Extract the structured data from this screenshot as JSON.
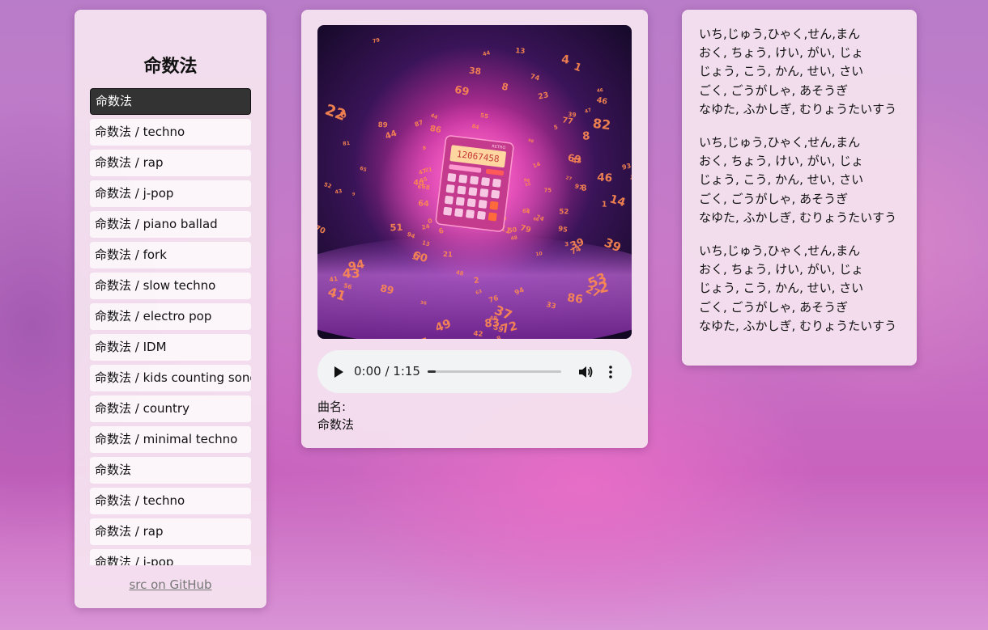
{
  "sidebar": {
    "title": "命数法",
    "tracks": [
      {
        "label": "命数法",
        "active": true
      },
      {
        "label": "命数法 / techno"
      },
      {
        "label": "命数法 / rap"
      },
      {
        "label": "命数法 / j-pop"
      },
      {
        "label": "命数法 / piano ballad"
      },
      {
        "label": "命数法 / fork"
      },
      {
        "label": "命数法 / slow techno"
      },
      {
        "label": "命数法 / electro pop"
      },
      {
        "label": "命数法 / IDM"
      },
      {
        "label": "命数法 / kids counting song"
      },
      {
        "label": "命数法 / country"
      },
      {
        "label": "命数法 / minimal techno"
      },
      {
        "label": "命数法"
      },
      {
        "label": "命数法 / techno"
      },
      {
        "label": "命数法 / rap"
      },
      {
        "label": "命数法 / j-pop"
      }
    ],
    "github_link": "src on GitHub"
  },
  "player": {
    "cover_display": "12067458",
    "cover_brand": "RETRO",
    "time": "0:00 / 1:15",
    "progress": 0.06,
    "song_label": "曲名:",
    "song_name": "命数法"
  },
  "lyrics": {
    "stanzas": [
      [
        "いち,じゅう,ひゃく,せん,まん",
        "おく, ちょう, けい, がい, じょ",
        "じょう, こう, かん, せい, さい",
        "ごく, ごうがしゃ, あそうぎ",
        "なゆた, ふかしぎ, むりょうたいすう"
      ],
      [
        "いち,じゅう,ひゃく,せん,まん",
        "おく, ちょう, けい, がい, じょ",
        "じょう, こう, かん, せい, さい",
        "ごく, ごうがしゃ, あそうぎ",
        "なゆた, ふかしぎ, むりょうたいすう"
      ],
      [
        "いち,じゅう,ひゃく,せん,まん",
        "おく, ちょう, けい, がい, じょ",
        "じょう, こう, かん, せい, さい",
        "ごく, ごうがしゃ, あそうぎ",
        "なゆた, ふかしぎ, むりょうたいすう"
      ]
    ]
  },
  "colors": {
    "active_track_bg": "#333333",
    "panel_bg": "#f5e4f0",
    "cover_glow": "#ff3fa8",
    "cover_digits": "#ff7a4a"
  }
}
